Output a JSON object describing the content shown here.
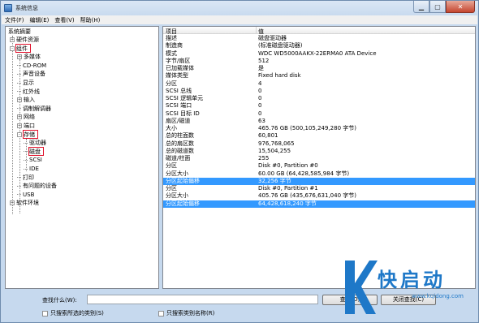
{
  "window": {
    "title": "系统信息"
  },
  "menu": [
    "文件(F)",
    "编辑(E)",
    "查看(V)",
    "帮助(H)"
  ],
  "tree": {
    "root": "系统摘要",
    "items": [
      {
        "label": "硬件资源",
        "level": 1,
        "expander": "+"
      },
      {
        "label": "组件",
        "level": 1,
        "expander": "-",
        "highlight": true
      },
      {
        "label": "多媒体",
        "level": 2,
        "expander": "+"
      },
      {
        "label": "CD-ROM",
        "level": 2
      },
      {
        "label": "声音设备",
        "level": 2
      },
      {
        "label": "显示",
        "level": 2
      },
      {
        "label": "红外线",
        "level": 2
      },
      {
        "label": "输入",
        "level": 2,
        "expander": "+"
      },
      {
        "label": "调制解调器",
        "level": 2
      },
      {
        "label": "网络",
        "level": 2,
        "expander": "+"
      },
      {
        "label": "端口",
        "level": 2,
        "expander": "+"
      },
      {
        "label": "存储",
        "level": 2,
        "expander": "-",
        "highlight": true
      },
      {
        "label": "驱动器",
        "level": 3
      },
      {
        "label": "磁盘",
        "level": 3,
        "highlight": true
      },
      {
        "label": "SCSI",
        "level": 3
      },
      {
        "label": "IDE",
        "level": 3
      },
      {
        "label": "打印",
        "level": 2
      },
      {
        "label": "有问题的设备",
        "level": 2
      },
      {
        "label": "USB",
        "level": 2
      },
      {
        "label": "软件环境",
        "level": 1,
        "expander": "+"
      }
    ]
  },
  "list": {
    "columns": [
      "项目",
      "值"
    ],
    "rows": [
      [
        "描述",
        "磁盘驱动器"
      ],
      [
        "制造商",
        "(标准磁盘驱动器)"
      ],
      [
        "模式",
        "WDC WD5000AAKX-22ERMA0 ATA Device"
      ],
      [
        "字节/扇区",
        "512"
      ],
      [
        "已加载媒体",
        "是"
      ],
      [
        "媒体类型",
        "Fixed hard disk"
      ],
      [
        "分区",
        "4"
      ],
      [
        "SCSI 总线",
        "0"
      ],
      [
        "SCSI 逻辑单元",
        "0"
      ],
      [
        "SCSI 端口",
        "0"
      ],
      [
        "SCSI 目标 ID",
        "0"
      ],
      [
        "扇区/磁道",
        "63"
      ],
      [
        "大小",
        "465.76 GB (500,105,249,280 字节)"
      ],
      [
        "总的柱面数",
        "60,801"
      ],
      [
        "总的扇区数",
        "976,768,065"
      ],
      [
        "总的磁道数",
        "15,504,255"
      ],
      [
        "磁道/柱面",
        "255"
      ],
      [
        "分区",
        "Disk #0, Partition #0"
      ],
      [
        "分区大小",
        "60.00 GB (64,428,585,984 字节)"
      ],
      [
        "分区起始偏移",
        "32,256 字节"
      ],
      [
        "分区",
        "Disk #0, Partition #1"
      ],
      [
        "分区大小",
        "405.76 GB (435,676,631,040 字节)"
      ],
      [
        "分区起始偏移",
        "64,428,618,240 字节"
      ]
    ],
    "selected_rows": [
      19,
      22
    ]
  },
  "bottom": {
    "find_label": "查找什么(W):",
    "find_value": "",
    "find_button": "查找(D)",
    "close_find_button": "关闭查找(C)",
    "chk_selected": "只搜索所选的类别(S)",
    "chk_names": "只搜索类别名称(R)"
  },
  "watermark": {
    "text": "快启动",
    "url": "www.kqidong.com"
  },
  "colors": {
    "selection": "#3399ff",
    "highlight_box": "#e0102a",
    "watermark": "#1e78c8"
  }
}
